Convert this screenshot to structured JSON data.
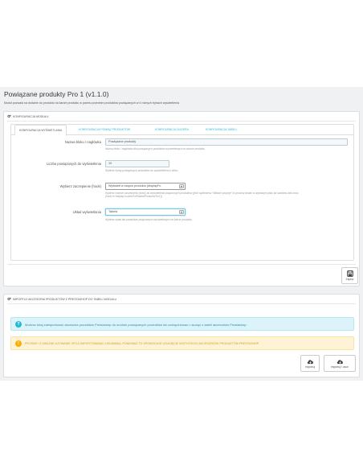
{
  "header": {
    "title": "Powiązane produkty Pro 1 (v1.1.0)",
    "subtitle": "Moduł pozwala na dodanie do produktu na karcie produktu w panelu przednim produktów powiązanych w 4 różnych trybach wyświetlenia"
  },
  "config_panel": {
    "heading": "KONFIGURACJA MODUŁU",
    "tabs": [
      {
        "label": "KONFIGURACJA WYŚWIETLANIA",
        "active": true
      },
      {
        "label": "KONFIGURACJA POWIĄŻ PRODUKTÓW",
        "active": false
      },
      {
        "label": "KONFIGURACJA SLIDERA",
        "active": false
      },
      {
        "label": "KONFIGURACJA TABELI",
        "active": false
      }
    ],
    "fields": {
      "block_name": {
        "label": "Nazwa bloku / nagłówka",
        "value": "Powiązane produkty",
        "help": "Nazwa bloku / nagłówka dla powiązanych produktów wyświetlanych na stronie produktu"
      },
      "count": {
        "label": "Liczba powiązanych do wyświetlenia",
        "value": "10",
        "help": "Wybierz liczbę powiązanych produktów do wyświetlenia w bloku"
      },
      "hook": {
        "label": "Wybierz zaczepienie (hook)",
        "value": "Wyświetl w stopce produktu (displayFo",
        "help": "Wybierz miejsce zaczepienia (hook) do wyświetlenia połączonych produktów (jeśli wybierzesz \"Własne pozycje\" to prosimy dodać w wybranym pliku tpl szablonu taki kodu (hook:h='displayCustomPoRelatedProductsPro1'))"
      },
      "layout": {
        "label": "Układ wyświetlania",
        "value": "Tabela",
        "help": "Wybierz układ dla produktów połączonych wyświetlanych na karcie produktu"
      }
    },
    "save_label": "Zapisz"
  },
  "import_panel": {
    "heading": "IMPORTUJ AKCESORIA PRODUKTÓW Z PRESTASHOP DO TABELI MODUŁU",
    "info_text": "Możesz tutaj zaimportować akcesoria produktów Prestashop do modułu powiązanych produktów lub zaimportować i usunąć z tabeli akcesoriów Prestashop.",
    "warning_text": "PROSIMY O UWAŻNE UŻYWANIE OPCJI IMPORTOWANIA I USUWANIA, PONIEWAŻ TO SPOWODUJE USUNIĘCIE WSZYSTKICH AKCESORIÓW PRODUKTÓW PRESTASHOP.",
    "import_label": "Importuj",
    "import_delete_label": "Importuj i usuń"
  },
  "colors": {
    "accent": "#25b9d7",
    "info_bg": "#dcf4f9",
    "warning_bg": "#fff3d7",
    "warning": "#fab000"
  }
}
